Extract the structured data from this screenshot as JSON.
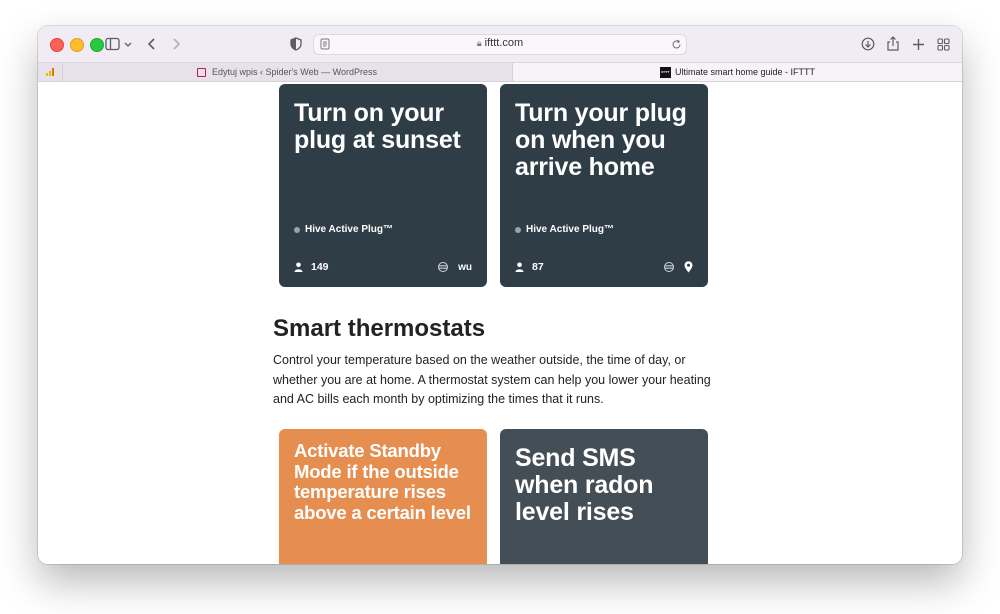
{
  "browser": {
    "address": "ifttt.com",
    "tabs": [
      {
        "title": "Edytuj wpis ‹ Spider's Web — WordPress"
      },
      {
        "title": "Ultimate smart home guide - IFTTT",
        "favicon": "IFTTT"
      }
    ]
  },
  "cards_top": [
    {
      "title": "Turn on your plug at sunset",
      "service": "Hive Active Plug™",
      "users": "149",
      "badge": "wu",
      "color": "#2e3d46"
    },
    {
      "title": "Turn your plug on when you arrive home",
      "service": "Hive Active Plug™",
      "users": "87",
      "badge": "location-pin-icon",
      "color": "#2e3d46"
    }
  ],
  "section": {
    "title": "Smart thermostats",
    "text": "Control your temperature based on the weather outside, the time of day, or whether you are at home. A thermostat system can help you lower your heating and AC bills each month by optimizing the times that it runs."
  },
  "cards_bottom": [
    {
      "title": "Activate Standby Mode if the outside temperature rises above a certain level",
      "color": "#e58e50"
    },
    {
      "title": "Send SMS when radon level rises",
      "color": "#434e56"
    }
  ]
}
